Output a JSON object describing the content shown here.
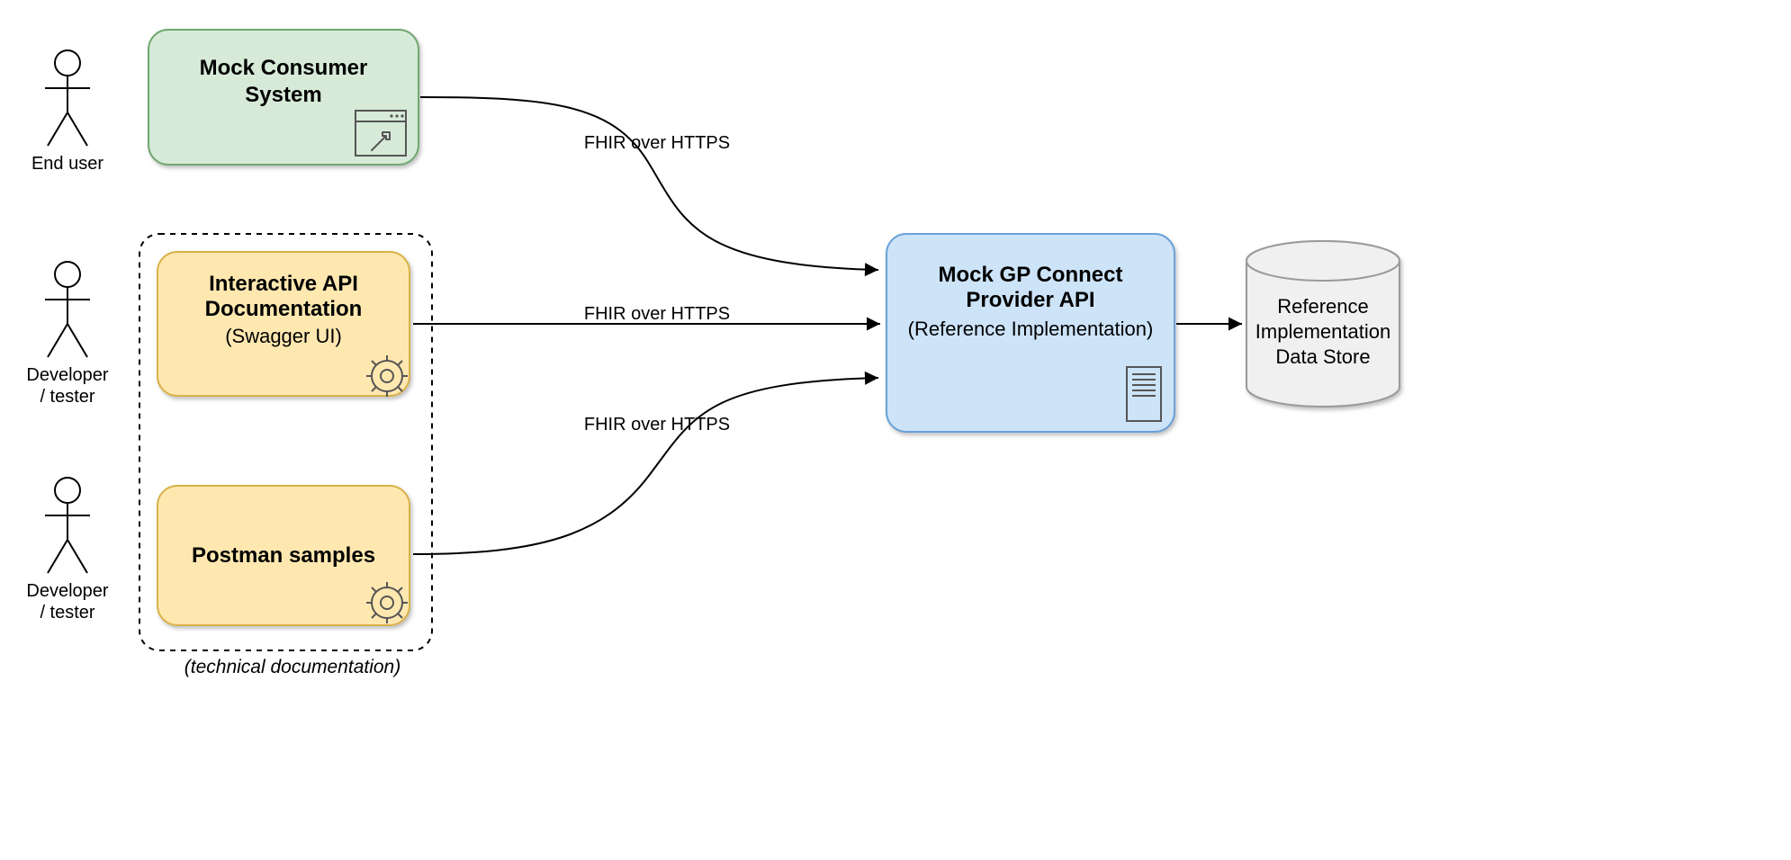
{
  "actors": {
    "endUser": {
      "line1": "End user"
    },
    "devTester1": {
      "line1": "Developer",
      "line2": "/ tester"
    },
    "devTester2": {
      "line1": "Developer",
      "line2": "/ tester"
    }
  },
  "nodes": {
    "mockConsumer": {
      "title1": "Mock Consumer",
      "title2": "System"
    },
    "interactiveApi": {
      "title1": "Interactive API",
      "title2": "Documentation",
      "subtitle": "(Swagger UI)"
    },
    "postmanSamples": {
      "title1": "Postman samples"
    },
    "mockProvider": {
      "title1": "Mock GP Connect",
      "title2": "Provider API",
      "subtitle": "(Reference Implementation)"
    },
    "dataStore": {
      "line1": "Reference",
      "line2": "Implementation",
      "line3": "Data Store"
    }
  },
  "groups": {
    "techDoc": {
      "caption": "(technical documentation)"
    }
  },
  "edges": {
    "e1": {
      "label": "FHIR over HTTPS"
    },
    "e2": {
      "label": "FHIR over HTTPS"
    },
    "e3": {
      "label": "FHIR over HTTPS"
    }
  }
}
